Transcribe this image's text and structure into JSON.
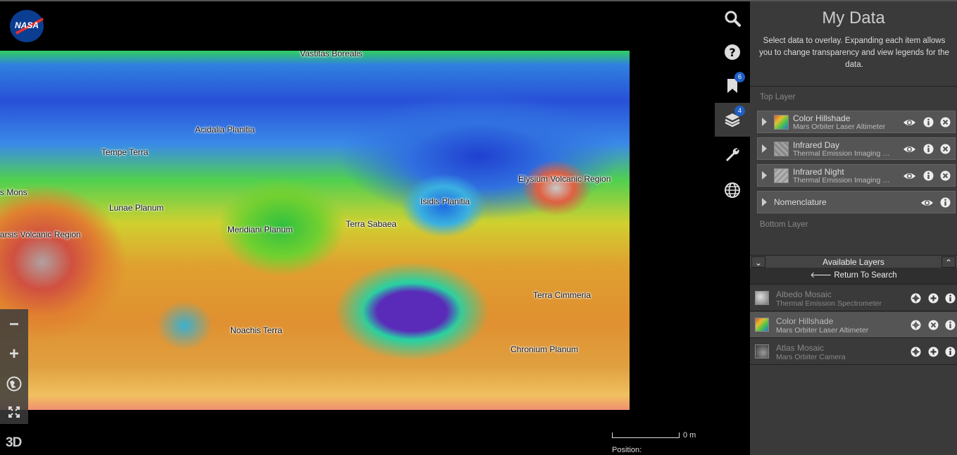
{
  "map": {
    "labels": [
      "Vastitas Borealis",
      "Acidalia Planitia",
      "Tempe Terra",
      "s Mons",
      "Lunae Planum",
      "arsis Volcanic Region",
      "Meridiani Planum",
      "Terra Sabaea",
      "Isidis Planitia",
      "Elysium Volcanic Region",
      "Terra Cimmeria",
      "Noachis Terra",
      "Chronium Planum"
    ]
  },
  "logo": {
    "text": "NASA"
  },
  "left_tools": {
    "zoom_out": "−",
    "zoom_in": "+",
    "toggle_3d": "3D"
  },
  "scale": {
    "label": "0 m"
  },
  "position": {
    "label": "Position:"
  },
  "rail": {
    "bookmark_badge": "6",
    "layers_badge": "4"
  },
  "panel": {
    "title": "My Data",
    "description": "Select data to overlay. Expanding each item allows you to change transparency and view legends for the data.",
    "top_layer_label": "Top Layer",
    "bottom_layer_label": "Bottom Layer",
    "layers": [
      {
        "name": "Color Hillshade",
        "source": "Mars Orbiter Laser Altimeter"
      },
      {
        "name": "Infrared Day",
        "source": "Thermal Emission Imaging System"
      },
      {
        "name": "Infrared Night",
        "source": "Thermal Emission Imaging System"
      },
      {
        "name": "Nomenclature"
      }
    ]
  },
  "available": {
    "title": "Available Layers",
    "return_label": "Return To Search",
    "items": [
      {
        "name": "Albedo Mosaic",
        "source": "Thermal Emission Spectrometer"
      },
      {
        "name": "Color Hillshade",
        "source": "Mars Orbiter Laser Altimeter"
      },
      {
        "name": "Atlas Mosaic",
        "source": "Mars Orbiter Camera"
      }
    ]
  }
}
